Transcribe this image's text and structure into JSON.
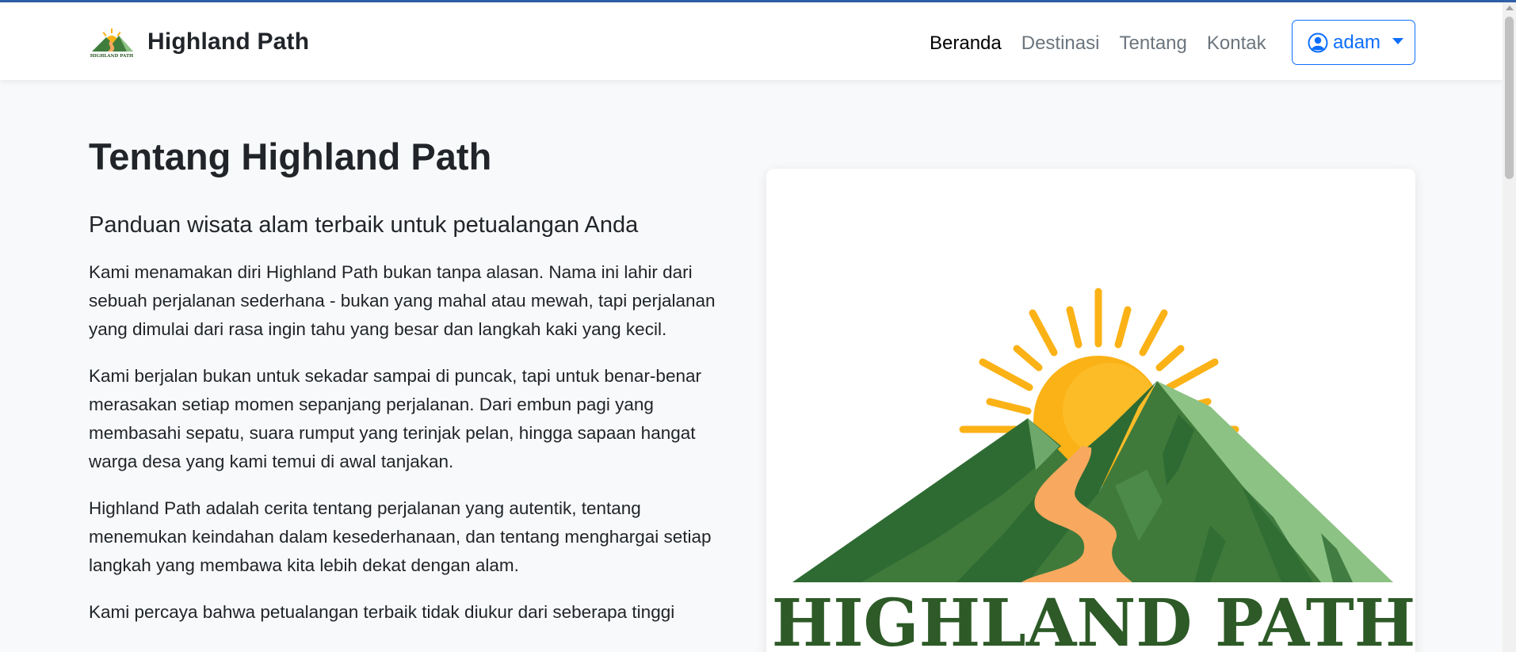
{
  "brand": {
    "name": "Highland Path",
    "logo_text": "HIGHLAND PATH"
  },
  "nav": {
    "items": [
      {
        "label": "Beranda",
        "active": true
      },
      {
        "label": "Destinasi",
        "active": false
      },
      {
        "label": "Tentang",
        "active": false
      },
      {
        "label": "Kontak",
        "active": false
      }
    ]
  },
  "user": {
    "name": "adam",
    "icon": "user-circle-icon"
  },
  "main": {
    "title": "Tentang Highland Path",
    "lead": "Panduan wisata alam terbaik untuk petualangan Anda",
    "paragraphs": [
      "Kami menamakan diri Highland Path bukan tanpa alasan. Nama ini lahir dari sebuah perjalanan sederhana - bukan yang mahal atau mewah, tapi perjalanan yang dimulai dari rasa ingin tahu yang besar dan langkah kaki yang kecil.",
      "Kami berjalan bukan untuk sekadar sampai di puncak, tapi untuk benar-benar merasakan setiap momen sepanjang perjalanan. Dari embun pagi yang membasahi sepatu, suara rumput yang terinjak pelan, hingga sapaan hangat warga desa yang kami temui di awal tanjakan.",
      "Highland Path adalah cerita tentang perjalanan yang autentik, tentang menemukan keindahan dalam kesederhanaan, dan tentang menghargai setiap langkah yang membawa kita lebih dekat dengan alam.",
      "Kami percaya bahwa petualangan terbaik tidak diukur dari seberapa tinggi"
    ]
  },
  "colors": {
    "primary": "#0d6efd",
    "sun": "#fbb216",
    "mountain_dark": "#2e6b33",
    "mountain_mid": "#4d8c4a",
    "mountain_light": "#8cc283",
    "path": "#f8a95f",
    "logo_text": "#2d5a27"
  }
}
